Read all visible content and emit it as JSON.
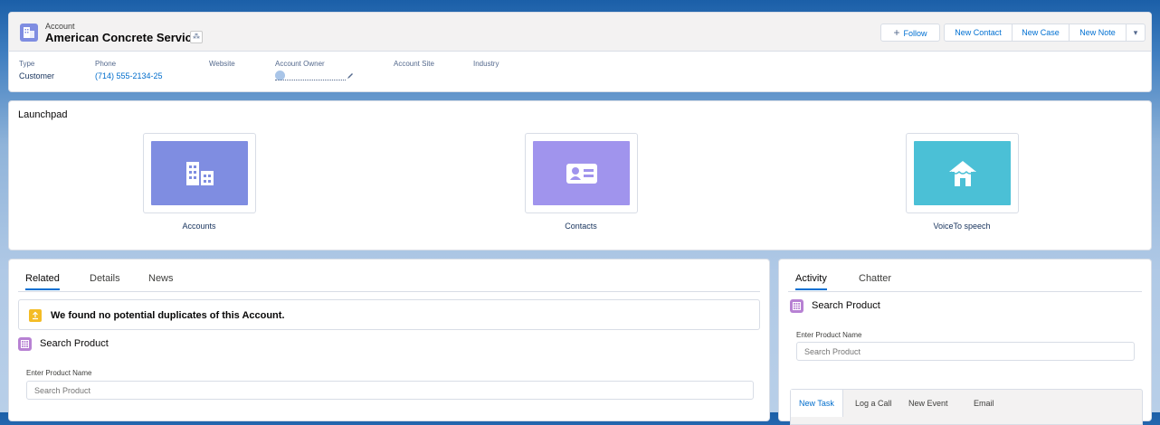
{
  "header": {
    "object_label": "Account",
    "record_title": "American Concrete Service",
    "hierarchy_glyph": "⁂",
    "actions": [
      "Follow",
      "New Contact",
      "New Case",
      "New Note"
    ],
    "follow_glyph": "+",
    "menu_glyph": "▾",
    "fields": [
      {
        "label": "Type",
        "value": "Customer"
      },
      {
        "label": "Phone",
        "value": "(714) 555-2134-25"
      },
      {
        "label": "Website",
        "value": ""
      },
      {
        "label": "Account Owner",
        "value": ""
      },
      {
        "label": "Account Site",
        "value": ""
      },
      {
        "label": "Industry",
        "value": ""
      }
    ]
  },
  "launchpad": {
    "title": "Launchpad",
    "tiles": [
      {
        "label": "Accounts",
        "icon": "building-icon",
        "color": "#7f8de1"
      },
      {
        "label": "Contacts",
        "icon": "contact-card-icon",
        "color": "#a094ed"
      },
      {
        "label": "VoiceTo speech",
        "icon": "hut-icon",
        "color": "#4bc0d6"
      }
    ]
  },
  "related": {
    "tabs": [
      "Related",
      "Details",
      "News"
    ],
    "duplicates_message": "We found no potential duplicates of this Account.",
    "search_title": "Search Product",
    "input_label": "Enter Product Name",
    "input_placeholder": "Search Product"
  },
  "activity": {
    "tabs": [
      "Activity",
      "Chatter"
    ],
    "search_title": "Search Product",
    "input_label": "Enter Product Name",
    "input_placeholder": "Search Product",
    "publisher_tabs": [
      "New Task",
      "Log a Call",
      "New Event",
      "Email"
    ]
  }
}
